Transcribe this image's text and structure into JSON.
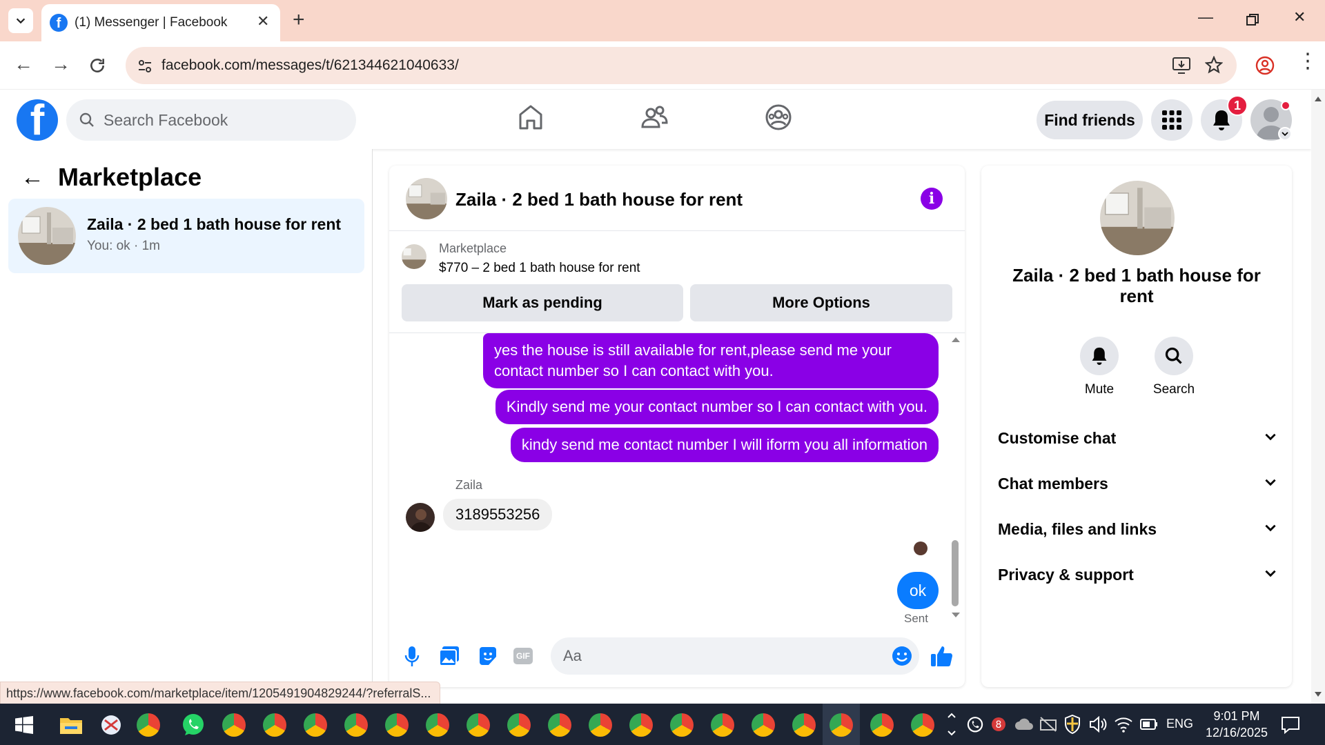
{
  "browser": {
    "tab_title": "(1) Messenger | Facebook",
    "url": "facebook.com/messages/t/621344621040633/",
    "status_url": "https://www.facebook.com/marketplace/item/1205491904829244/?referralS..."
  },
  "fb_header": {
    "search_placeholder": "Search Facebook",
    "find_friends": "Find friends",
    "notification_count": "1"
  },
  "left_panel": {
    "title": "Marketplace",
    "conversation": {
      "name": "Zaila · 2 bed 1 bath house for rent",
      "preview": "You: ok · 1m"
    }
  },
  "chat": {
    "title": "Zaila · 2 bed 1 bath house for rent",
    "marketplace_label": "Marketplace",
    "listing": "$770 – 2 bed 1 bath house for rent",
    "mark_pending": "Mark as pending",
    "more_options": "More Options",
    "messages_out": [
      "yes the house is still available for rent,please send me your contact number so I can contact with you.",
      "Kindly send me your contact number so I can contact with you.",
      "kindy send me contact number I will iform you all information"
    ],
    "sender_name": "Zaila",
    "incoming": "3189553256",
    "last_out": "ok",
    "sent_status": "Sent",
    "composer_placeholder": "Aa"
  },
  "right_panel": {
    "name": "Zaila · 2 bed 1 bath house for rent",
    "mute": "Mute",
    "search": "Search",
    "rows": [
      "Customise chat",
      "Chat members",
      "Media, files and links",
      "Privacy & support"
    ]
  },
  "taskbar": {
    "lang": "ENG",
    "time": "9:01 PM",
    "date": "12/16/2025"
  },
  "colors": {
    "fb_blue": "#1877f2",
    "bubble_purple": "#8a00e6",
    "tab_strip": "#f9d7cb"
  }
}
